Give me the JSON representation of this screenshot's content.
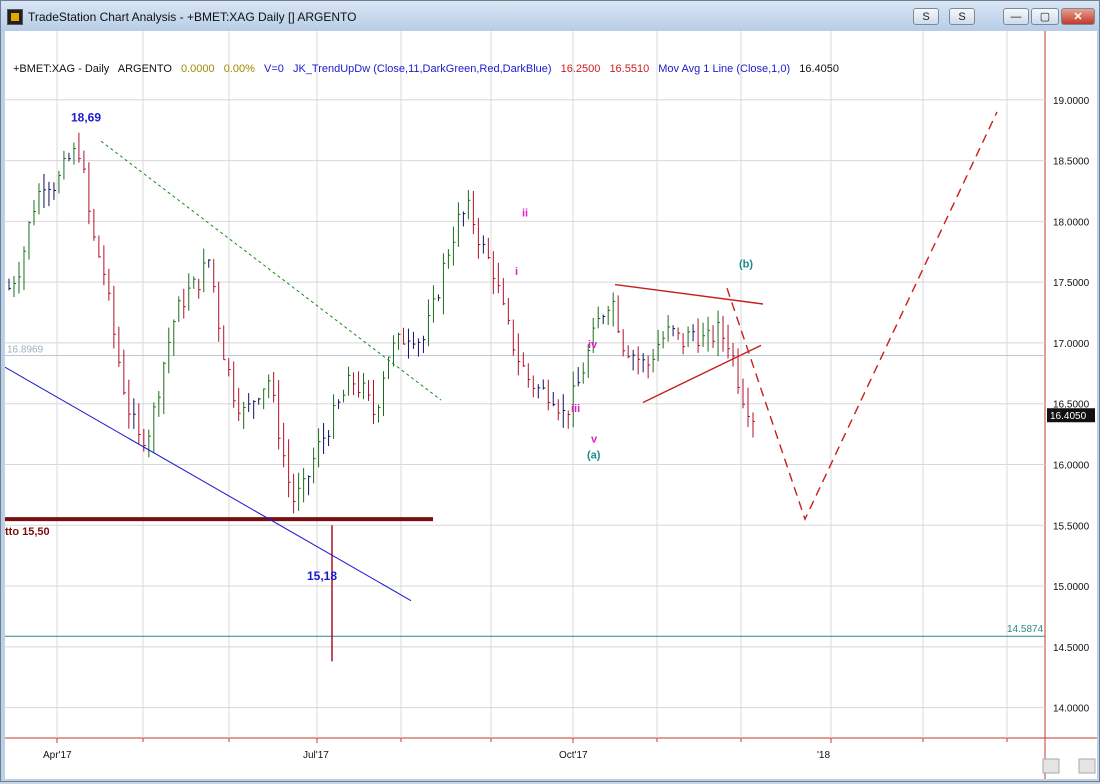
{
  "window": {
    "title": "TradeStation Chart Analysis - +BMET:XAG Daily [] ARGENTO",
    "buttons": {
      "s1": "S",
      "s2": "S",
      "minimize": "—",
      "maximize": "▢",
      "close": "✕"
    }
  },
  "status_line": {
    "symbol": "+BMET:XAG - Daily",
    "name": "ARGENTO",
    "change": "0.0000",
    "change_pct": "0.00%",
    "volume": "V=0",
    "indicator1": "JK_TrendUpDw (Close,11,DarkGreen,Red,DarkBlue)",
    "ind1_v1": "16.2500",
    "ind1_v2": "16.5510",
    "indicator2": "Mov Avg 1 Line (Close,1,0)",
    "ind2_v1": "16.4050"
  },
  "annotations": {
    "high_label": "18,69",
    "low_label": "15,18",
    "support_label": "tto 15,50",
    "wave_i": "i",
    "wave_ii": "ii",
    "wave_iii": "iii",
    "wave_iv": "iv",
    "wave_v": "v",
    "wave_a": "(a)",
    "wave_b": "(b)"
  },
  "price_tags": {
    "current": "16.4050",
    "level1": "16.8969",
    "level2": "14.5874"
  },
  "colors": {
    "up_bars": "#1a6e1a",
    "down_bars": "#b0102a",
    "neutral_bars": "#101060",
    "wave_labels": "#e020c0",
    "abc_labels": "#1b8a8a",
    "blue_text": "#1a1ad0",
    "support_line": "#7a0e0e",
    "projection": "#c81e1e"
  },
  "chart_data": {
    "type": "line",
    "title": "",
    "xlabel": "",
    "ylabel": "",
    "x_ticks": [
      "Apr'17",
      "Jul'17",
      "Oct'17",
      "'18"
    ],
    "y_ticks": [
      "14.0000",
      "14.5000",
      "15.0000",
      "15.5000",
      "16.0000",
      "16.5000",
      "17.0000",
      "17.5000",
      "18.0000",
      "18.5000",
      "19.0000"
    ],
    "ylim": [
      13.75,
      19.5
    ],
    "legend": "none",
    "series": [
      {
        "values": [
          17.45,
          17.65,
          18.1,
          18.35,
          18.3,
          18.5,
          18.6,
          17.9,
          17.6,
          17.0,
          16.5,
          16.2,
          16.3,
          16.8,
          17.2,
          17.4,
          17.5,
          17.7,
          17.0,
          16.6,
          16.4,
          16.6,
          16.7,
          16.2,
          15.7,
          15.8,
          16.1,
          16.3,
          16.5,
          16.7,
          16.6,
          16.4,
          16.9,
          17.0,
          17.1,
          17.0,
          17.3,
          17.7,
          18.0,
          18.1,
          17.8,
          17.6,
          17.2,
          16.9,
          16.7,
          16.6,
          16.6,
          16.4,
          16.6,
          16.9,
          17.2,
          17.4,
          17.0,
          16.9,
          16.8,
          17.0,
          17.1,
          17.0,
          17.1,
          17.0,
          17.1,
          17.0,
          16.6,
          16.4
        ]
      }
    ],
    "lines": [
      {
        "name": "support",
        "y": 15.55
      },
      {
        "name": "level",
        "y": 16.8969
      },
      {
        "name": "level",
        "y": 14.5874
      }
    ]
  }
}
